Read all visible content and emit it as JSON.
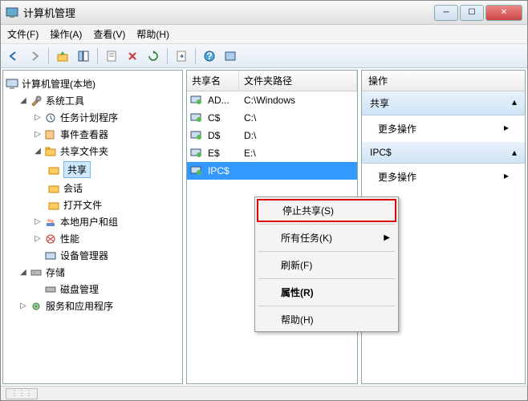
{
  "window": {
    "title": "计算机管理"
  },
  "menu": {
    "file": "文件(F)",
    "action": "操作(A)",
    "view": "查看(V)",
    "help": "帮助(H)"
  },
  "tree": {
    "root": "计算机管理(本地)",
    "system_tools": "系统工具",
    "task_scheduler": "任务计划程序",
    "event_viewer": "事件查看器",
    "shared_folders": "共享文件夹",
    "shares": "共享",
    "sessions": "会话",
    "open_files": "打开文件",
    "local_users": "本地用户和组",
    "performance": "性能",
    "device_manager": "设备管理器",
    "storage": "存储",
    "disk_mgmt": "磁盘管理",
    "services_apps": "服务和应用程序"
  },
  "list": {
    "col_share": "共享名",
    "col_path": "文件夹路径",
    "rows": [
      {
        "name": "AD...",
        "path": "C:\\Windows"
      },
      {
        "name": "C$",
        "path": "C:\\"
      },
      {
        "name": "D$",
        "path": "D:\\"
      },
      {
        "name": "E$",
        "path": "E:\\"
      },
      {
        "name": "IPC$",
        "path": ""
      }
    ]
  },
  "actions": {
    "header": "操作",
    "sec1": "共享",
    "more": "更多操作",
    "sec2": "IPC$"
  },
  "context": {
    "stop_share": "停止共享(S)",
    "all_tasks": "所有任务(K)",
    "refresh": "刷新(F)",
    "properties": "属性(R)",
    "help": "帮助(H)"
  }
}
